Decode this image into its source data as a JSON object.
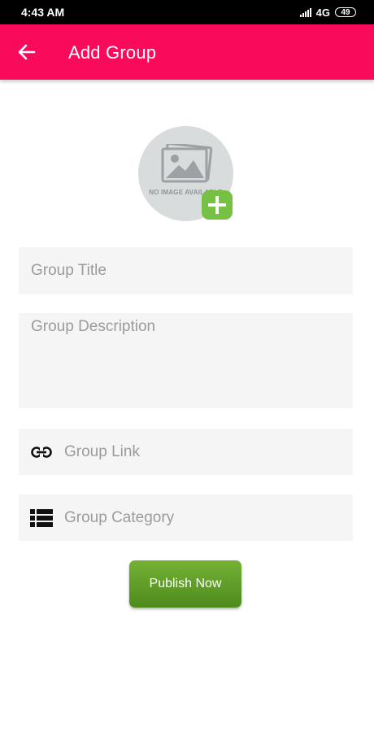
{
  "status_bar": {
    "time": "4:43 AM",
    "network": "4G",
    "battery": "49"
  },
  "app_bar": {
    "title": "Add Group",
    "back_icon": "arrow-left-icon",
    "color": "#fa0a5a"
  },
  "image_picker": {
    "placeholder_text": "NO IMAGE AVAILABLE",
    "add_icon": "plus-icon",
    "accent_color": "#76c043"
  },
  "form": {
    "title_placeholder": "Group Title",
    "description_placeholder": "Group Description",
    "link_placeholder": "Group Link",
    "link_icon": "link-icon",
    "category_placeholder": "Group Category",
    "category_icon": "list-icon"
  },
  "publish_button": {
    "label": "Publish Now",
    "color": "#5fa02a"
  }
}
